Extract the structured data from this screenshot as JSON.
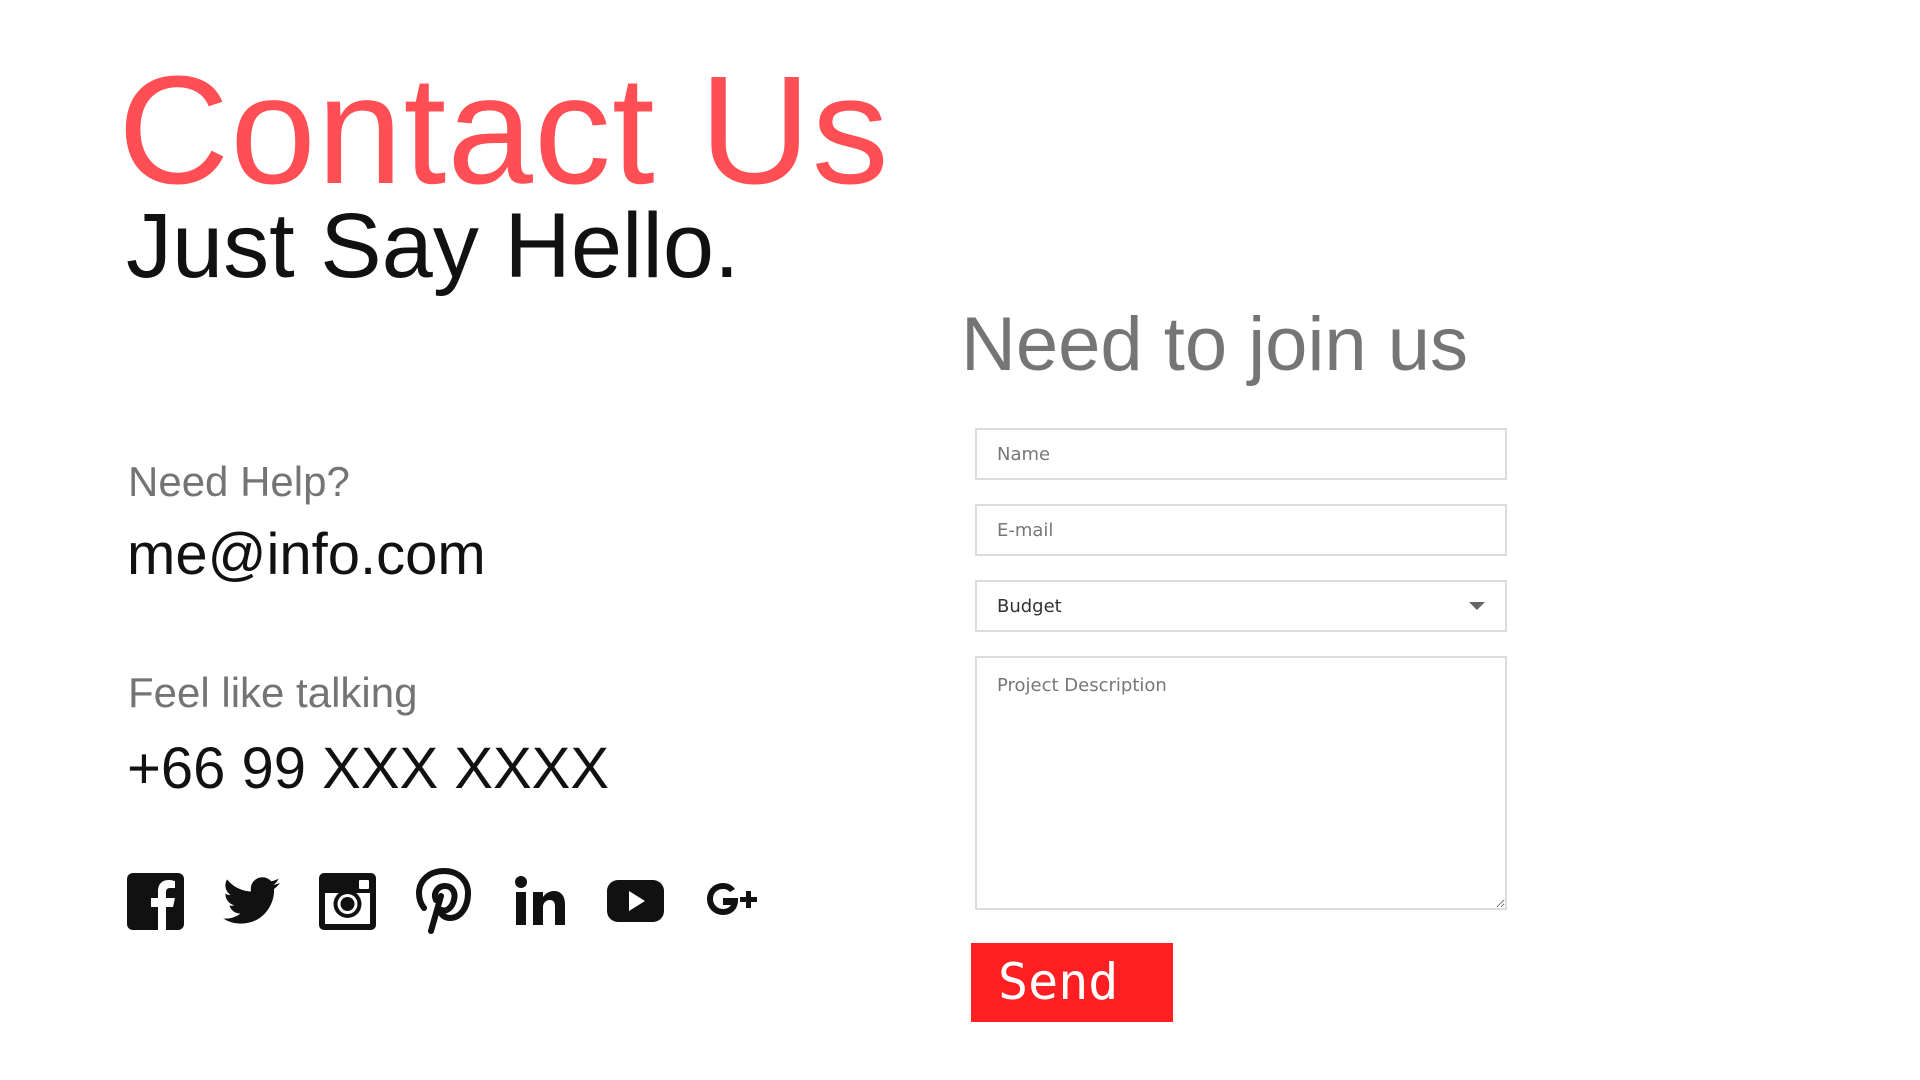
{
  "hero": {
    "title": "Contact Us",
    "subtitle": "Just Say Hello."
  },
  "contact": {
    "help_label": "Need Help?",
    "email": "me@info.com",
    "talk_label": "Feel like talking",
    "phone": "+66 99 XXX XXXX"
  },
  "social": {
    "icons": [
      "facebook-icon",
      "twitter-icon",
      "instagram-icon",
      "pinterest-icon",
      "linkedin-icon",
      "youtube-icon",
      "google-plus-icon"
    ]
  },
  "form": {
    "title": "Need to join us",
    "name_placeholder": "Name",
    "email_placeholder": "E-mail",
    "budget_value": "Budget",
    "description_placeholder": "Project Description",
    "send_label": "Send"
  },
  "colors": {
    "accent": "#ff4f55",
    "send_button": "#ff1f23",
    "muted_text": "#757575",
    "dark_text": "#111111"
  }
}
